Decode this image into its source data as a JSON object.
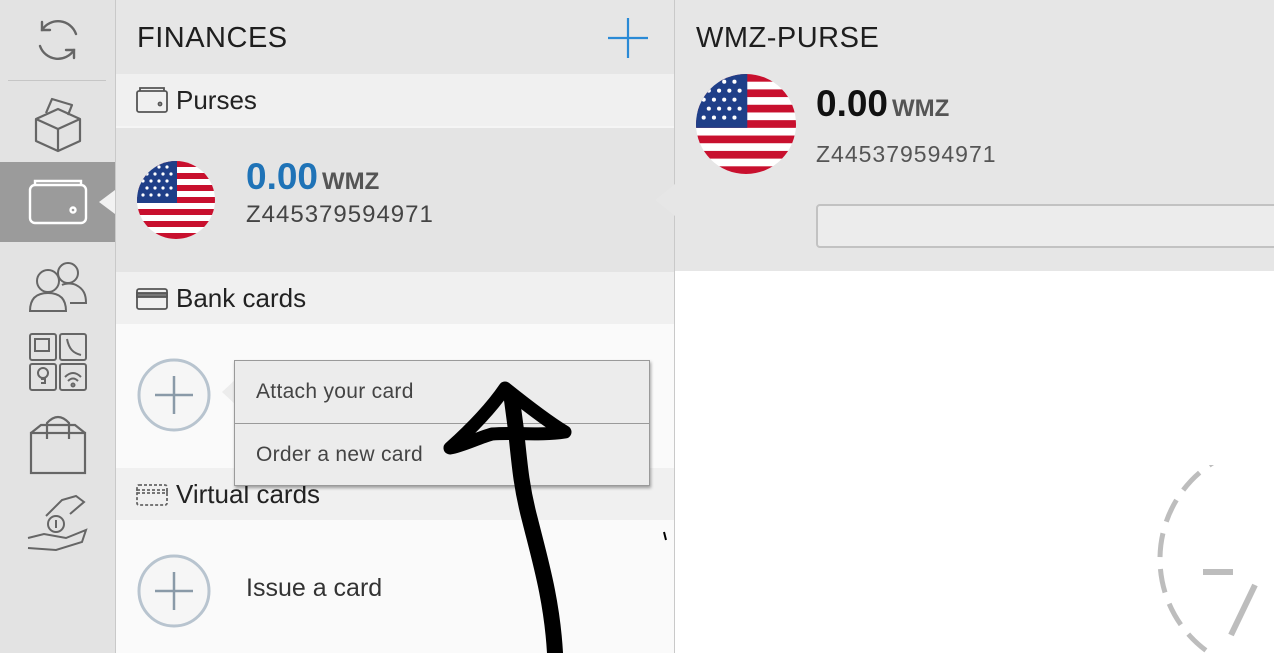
{
  "sidebar": {
    "items": [
      {
        "icon": "refresh-icon"
      },
      {
        "icon": "box-icon"
      },
      {
        "icon": "wallet-icon",
        "active": true
      },
      {
        "icon": "contacts-icon"
      },
      {
        "icon": "services-icon"
      },
      {
        "icon": "shopping-bag-icon"
      },
      {
        "icon": "hand-coin-icon"
      }
    ]
  },
  "finances": {
    "title": "FINANCES",
    "add_icon": "plus-icon",
    "sections": {
      "purses": {
        "label": "Purses",
        "icon": "wallet-icon"
      },
      "bank_cards": {
        "label": "Bank cards",
        "icon": "card-icon"
      },
      "virtual_cards": {
        "label": "Virtual cards",
        "icon": "virtual-card-icon"
      }
    },
    "purse": {
      "amount": "0.00",
      "currency": "WMZ",
      "id": "Z445379594971",
      "flag": "us-flag-icon"
    },
    "bank_card_menu": {
      "items": [
        "Attach your card",
        "Order a new card"
      ]
    },
    "issue_card_label": "Issue a card"
  },
  "detail": {
    "title": "WMZ-PURSE",
    "amount": "0.00",
    "currency": "WMZ",
    "id": "Z445379594971",
    "input_value": ""
  },
  "colors": {
    "accent": "#1f73b7",
    "rail_bg": "#e3e3e3",
    "rail_active": "#9b9b9b",
    "panel_bg": "#e6e6e6"
  }
}
